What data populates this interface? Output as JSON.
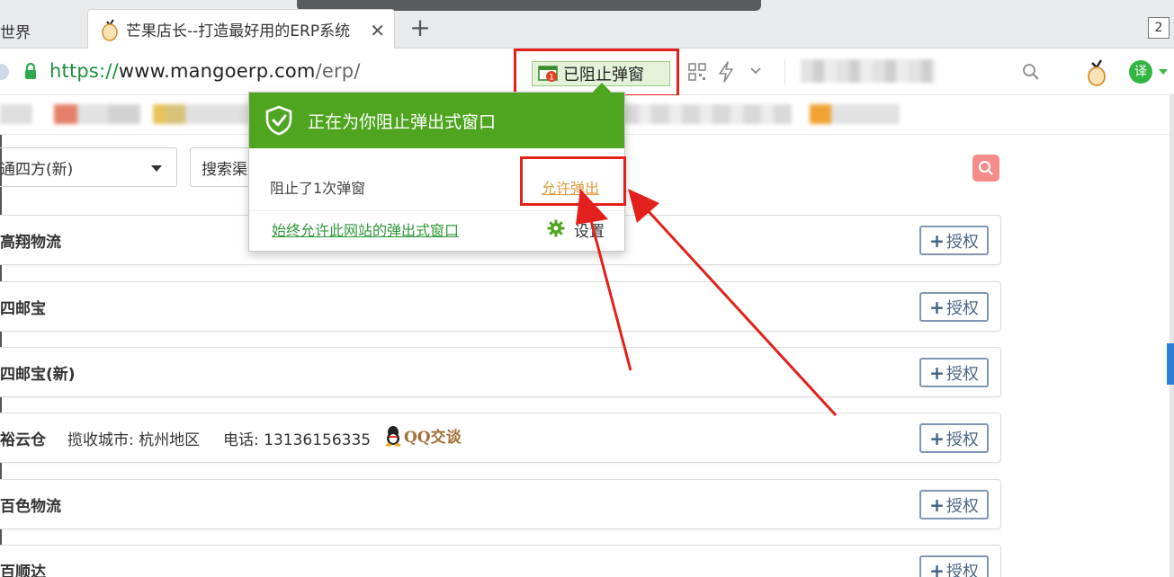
{
  "browser": {
    "prev_tab_label": "世界",
    "active_tab_title": "芒果店长--打造最好用的ERP系统",
    "tab_close": "✕",
    "new_tab": "+",
    "tab_count": "2",
    "url_scheme": "https://",
    "url_domain": "www.mangoerp.com",
    "url_path": "/erp/",
    "blocked_badge_count": "1",
    "blocked_label": "已阻止弹窗",
    "translate_label": "译"
  },
  "popup": {
    "title": "正在为你阻止弹出式窗口",
    "blocked_message": "阻止了1次弹窗",
    "allow_link": "允许弹出",
    "always_allow_link": "始终允许此网站的弹出式窗口",
    "settings_label": "设置"
  },
  "filters": {
    "city_select_value": "通四方(新)",
    "search_placeholder": "搜索渠道"
  },
  "carriers": [
    {
      "name": "高翔物流",
      "auth_label": "授权"
    },
    {
      "name": "四邮宝",
      "auth_label": "授权"
    },
    {
      "name": "四邮宝(新)",
      "auth_label": "授权"
    },
    {
      "name": "裕云仓",
      "city": "揽收城市: 杭州地区",
      "phone": "电话: 13136156335",
      "qq": "QQ交谈",
      "auth_label": "授权"
    },
    {
      "name": "百色物流",
      "auth_label": "授权"
    },
    {
      "name": "百顺达",
      "auth_label": "授权"
    }
  ],
  "colors": {
    "popup_green": "#4fa51f",
    "annotation_red": "#e3201b",
    "allow_link_orange": "#e09a3b",
    "always_link_green": "#2e9a37",
    "auth_border": "#7e96b4",
    "search_button": "#f48d8a"
  },
  "icons": [
    "lock-icon",
    "qr-code-icon",
    "lightning-icon",
    "chevron-down-icon",
    "search-icon",
    "mango-logo-icon",
    "translate-icon",
    "shield-check-icon",
    "gear-icon",
    "qq-penguin-icon",
    "blocked-window-icon"
  ]
}
